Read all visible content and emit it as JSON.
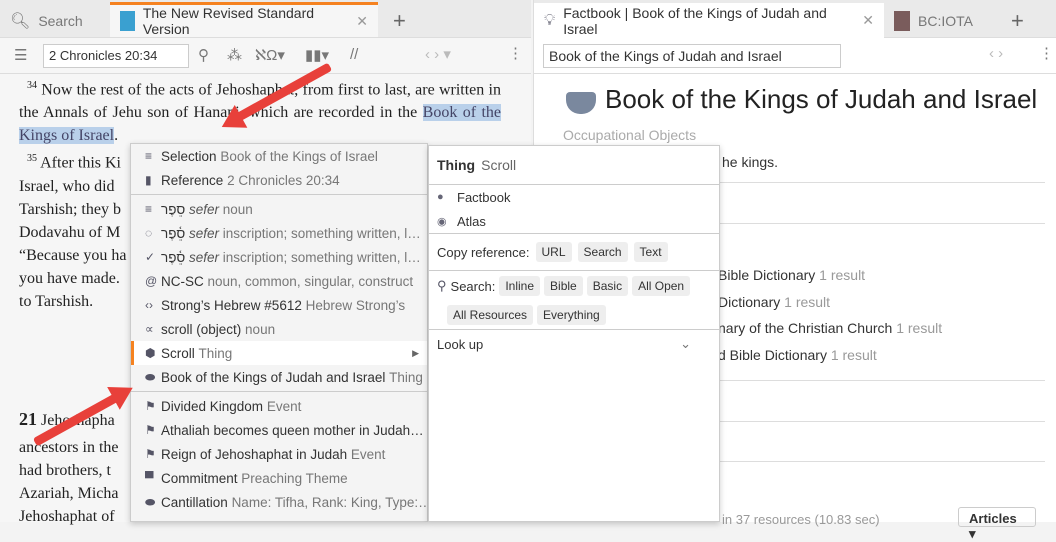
{
  "left": {
    "tabs": [
      {
        "label": "Search"
      },
      {
        "label": "The New Revised Standard Version"
      }
    ],
    "reference": "2 Chronicles 20:34",
    "verse34_num": "34",
    "verse34_pre": "Now the rest of the acts of Jehoshaphat, from first to last, are written in the Annals of Jehu son of Hanani, which are recorded in the ",
    "verse34_sel": "Book of the Kings of Israel",
    "verse34_post": ".",
    "verse35_num": "35",
    "verse35_lines": [
      "After this Ki",
      "Israel, who did",
      "Tarshish; they b",
      "Dodavahu of M",
      "“Because you ha",
      "you have made.",
      "to Tarshish."
    ],
    "ch21_num": "21",
    "ch21_lines": [
      "Jehoshapha",
      "ancestors in the",
      "had brothers, t",
      "Azariah, Micha",
      "Jehoshaphat of"
    ]
  },
  "menu": {
    "items": [
      {
        "icon": "lines-icon",
        "main": "Selection",
        "sec": "Book of the Kings of Israel"
      },
      {
        "icon": "bookmark-icon",
        "main": "Reference",
        "sec": "2 Chronicles 20:34"
      },
      {
        "icon": "lines-icon",
        "main": "סֵפֶר",
        "it": "sefer",
        "sec": "noun"
      },
      {
        "icon": "circle-icon",
        "main": "סֵ֫פֶר",
        "it": "sefer",
        "sec": "inscription; something written, l…"
      },
      {
        "icon": "check-icon",
        "main": "סֵ֫פֶר",
        "it": "sefer",
        "sec": "inscription; something written, l…"
      },
      {
        "icon": "at-icon",
        "main": "NC-SC",
        "sec": "noun, common, singular, construct"
      },
      {
        "icon": "code-icon",
        "main": "Strong’s Hebrew #5612",
        "sec": "Hebrew Strong’s"
      },
      {
        "icon": "alpha-icon",
        "main": "scroll (object)",
        "sec": "noun"
      },
      {
        "icon": "cube-icon",
        "main": "Scroll",
        "sec": "Thing"
      },
      {
        "icon": "bowl-icon",
        "main": "Book of the Kings of Judah and Israel",
        "sec": "Thing"
      },
      {
        "icon": "flag-icon",
        "main": "Divided Kingdom",
        "sec": "Event"
      },
      {
        "icon": "flag-icon",
        "main": "Athaliah becomes queen mother in Judah…",
        "sec": ""
      },
      {
        "icon": "flag-icon",
        "main": "Reign of Jehoshaphat in Judah",
        "sec": "Event"
      },
      {
        "icon": "podium-icon",
        "main": "Commitment",
        "sec": "Preaching Theme"
      },
      {
        "icon": "pill-icon",
        "main": "Cantillation",
        "sec": "Name: Tifha, Rank: King, Type:…"
      }
    ]
  },
  "submenu": {
    "title": "Thing",
    "subtitle": "Scroll",
    "factbook": "Factbook",
    "atlas": "Atlas",
    "copy_label": "Copy reference:",
    "copy_buttons": [
      "URL",
      "Search",
      "Text"
    ],
    "search_label": "Search:",
    "search_buttons": [
      "Inline",
      "Bible",
      "Basic",
      "All Open",
      "All Resources",
      "Everything"
    ],
    "lookup": "Look up"
  },
  "right": {
    "tabs": [
      {
        "label": "Factbook | Book of the Kings of Judah and Israel"
      },
      {
        "label": "BC:IOTA"
      }
    ],
    "search_value": "Book of the Kings of Judah and Israel",
    "title": "Book of the Kings of Judah and Israel",
    "category": "Occupational Objects",
    "desc_fragment": "he kings.",
    "results": [
      {
        "name": "Bible Dictionary",
        "count": "1 result"
      },
      {
        "name": "Dictionary",
        "count": "1 result"
      },
      {
        "name": "nary of the Christian Church",
        "count": "1 result"
      },
      {
        "name": "d Bible Dictionary",
        "count": "1 result"
      }
    ],
    "footer": "in 37 resources (10.83 sec)",
    "articles": "Articles"
  }
}
